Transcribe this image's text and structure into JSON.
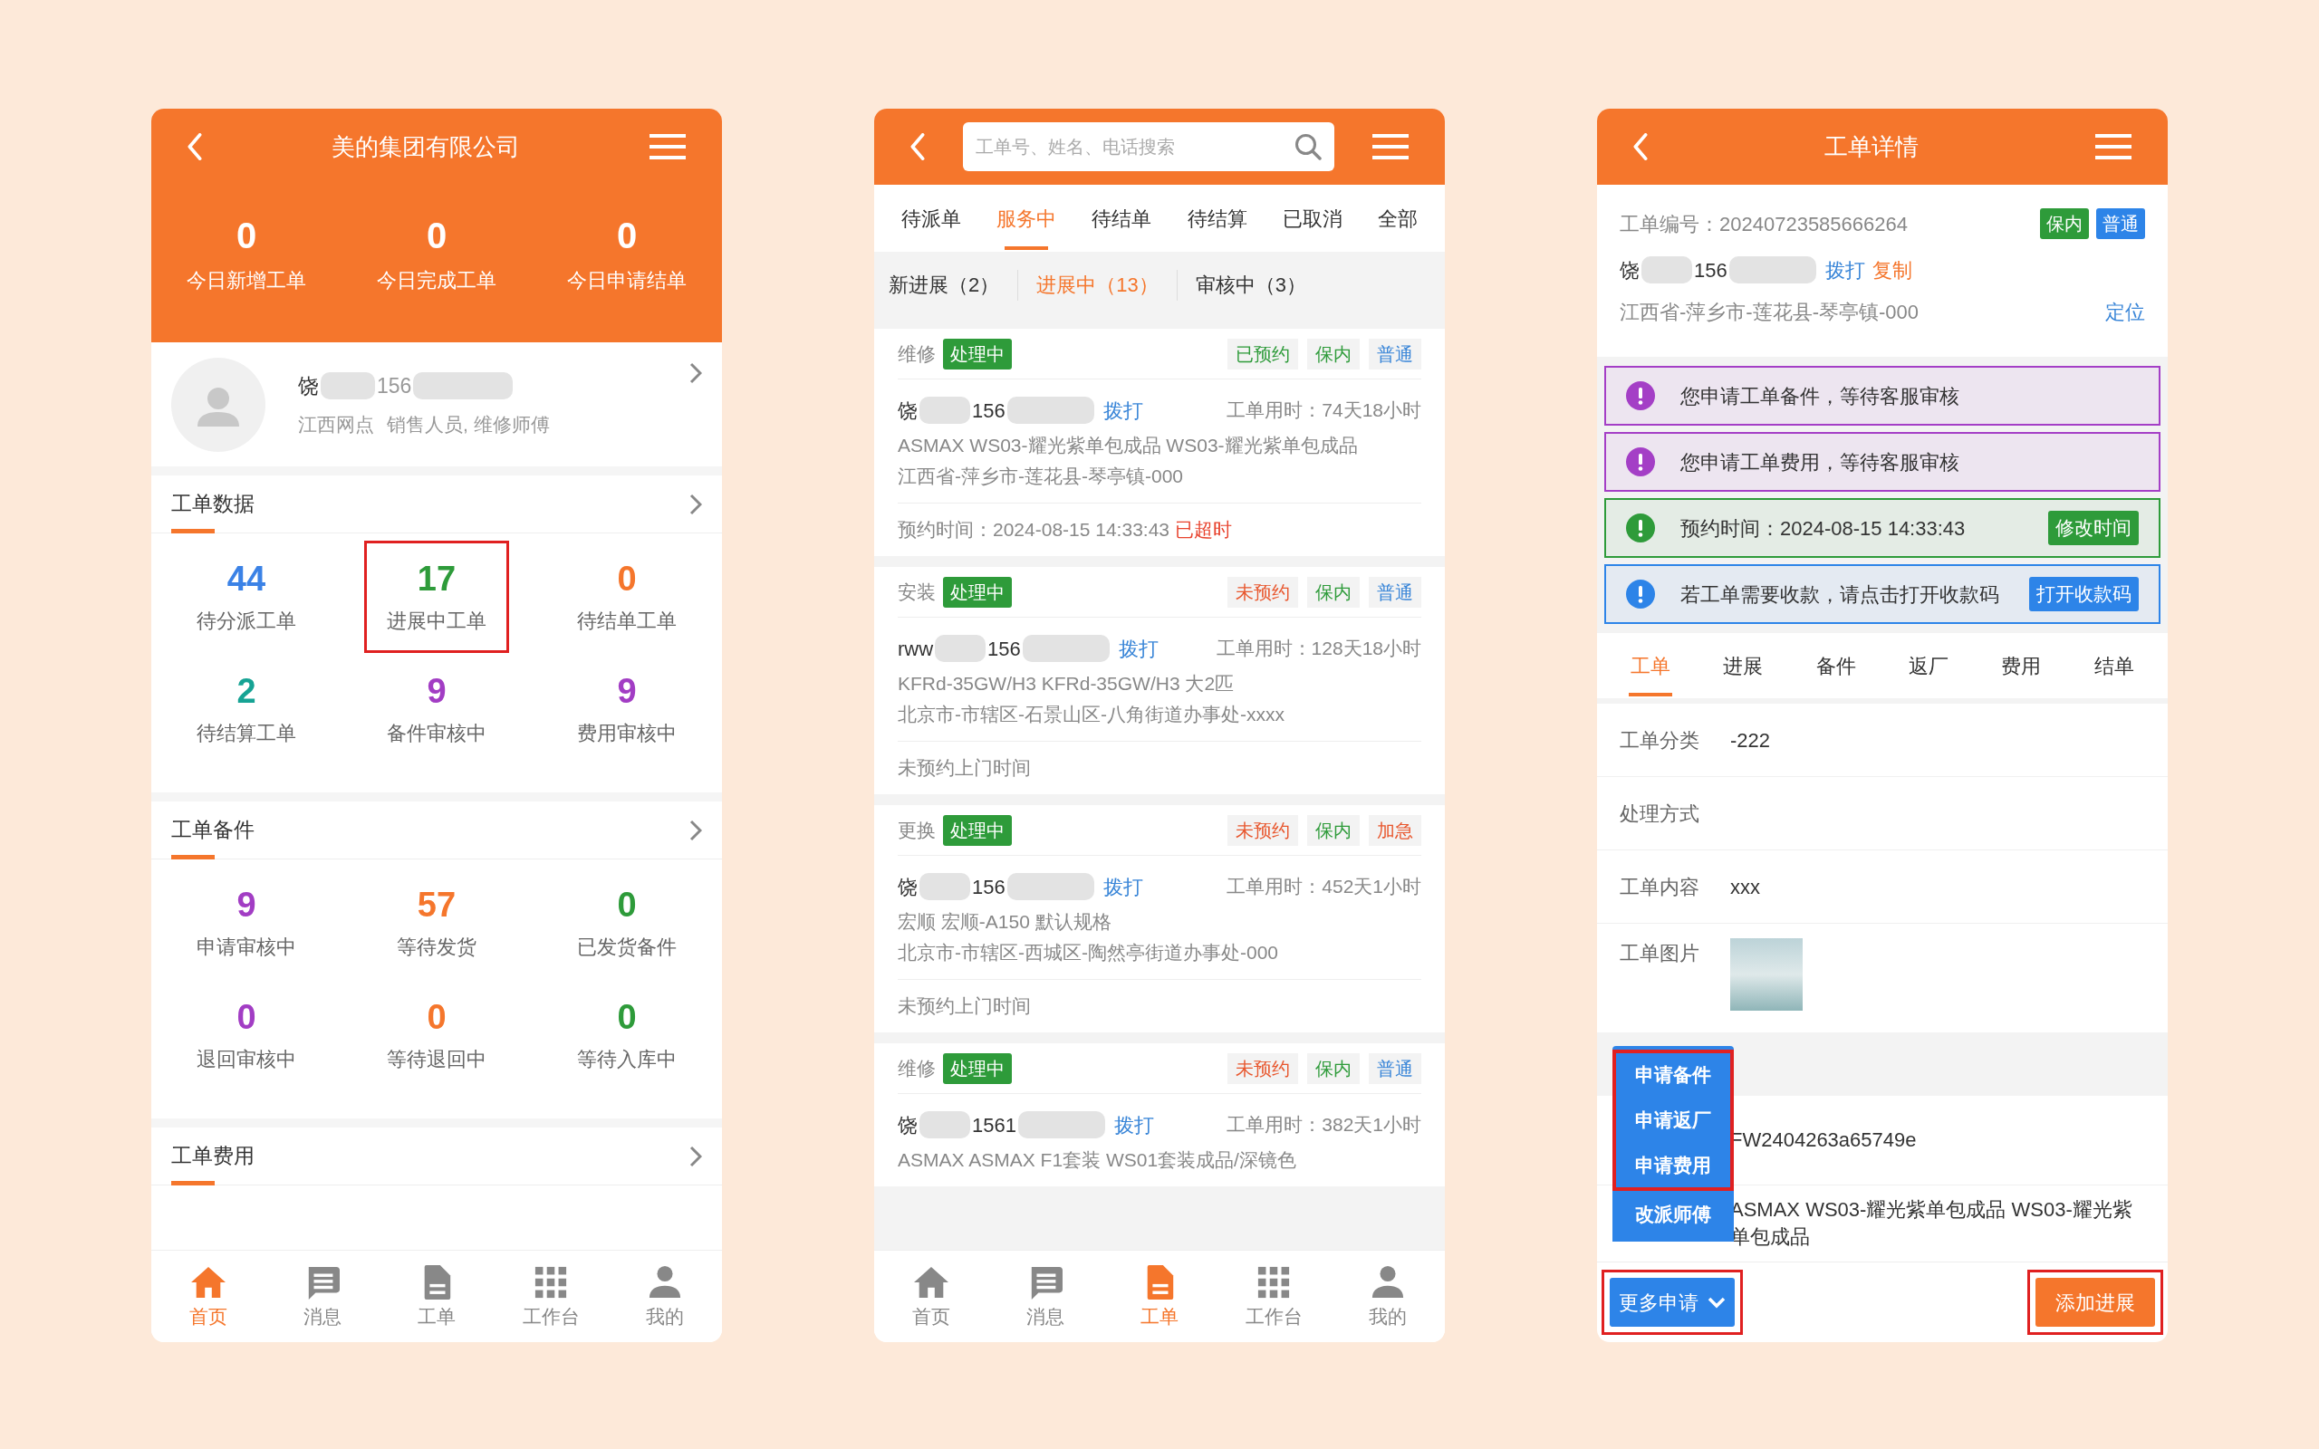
{
  "home_screen": {
    "title": "美的集团有限公司",
    "today_stats": [
      {
        "value": "0",
        "label": "今日新增工单"
      },
      {
        "value": "0",
        "label": "今日完成工单"
      },
      {
        "value": "0",
        "label": "今日申请结单"
      }
    ],
    "profile": {
      "name": "饶",
      "phone": "156",
      "org": "江西网点",
      "roles": "销售人员, 维修师傅"
    },
    "sections": [
      {
        "title": "工单数据",
        "stats": [
          {
            "value": "44",
            "label": "待分派工单",
            "color": "#3b82e6",
            "highlighted": false
          },
          {
            "value": "17",
            "label": "进展中工单",
            "color": "#2e9b3a",
            "highlighted": true
          },
          {
            "value": "0",
            "label": "待结单工单",
            "color": "#f5762c",
            "highlighted": false
          },
          {
            "value": "2",
            "label": "待结算工单",
            "color": "#16a394",
            "highlighted": false
          },
          {
            "value": "9",
            "label": "备件审核中",
            "color": "#a23dc4",
            "highlighted": false
          },
          {
            "value": "9",
            "label": "费用审核中",
            "color": "#a23dc4",
            "highlighted": false
          }
        ]
      },
      {
        "title": "工单备件",
        "stats": [
          {
            "value": "9",
            "label": "申请审核中",
            "color": "#a23dc4",
            "highlighted": false
          },
          {
            "value": "57",
            "label": "等待发货",
            "color": "#f5762c",
            "highlighted": false
          },
          {
            "value": "0",
            "label": "已发货备件",
            "color": "#2e9b3a",
            "highlighted": false
          },
          {
            "value": "0",
            "label": "退回审核中",
            "color": "#a23dc4",
            "highlighted": false
          },
          {
            "value": "0",
            "label": "等待退回中",
            "color": "#f5762c",
            "highlighted": false
          },
          {
            "value": "0",
            "label": "等待入库中",
            "color": "#2e9b3a",
            "highlighted": false
          }
        ]
      },
      {
        "title": "工单费用"
      }
    ],
    "nav": [
      {
        "label": "首页",
        "selected": true
      },
      {
        "label": "消息",
        "selected": false
      },
      {
        "label": "工单",
        "selected": false
      },
      {
        "label": "工作台",
        "selected": false
      },
      {
        "label": "我的",
        "selected": false
      }
    ]
  },
  "order_list_screen": {
    "search": {
      "placeholder": "工单号、姓名、电话搜索"
    },
    "tabs": [
      {
        "label": "待派单",
        "selected": false
      },
      {
        "label": "服务中",
        "selected": true
      },
      {
        "label": "待结单",
        "selected": false
      },
      {
        "label": "待结算",
        "selected": false
      },
      {
        "label": "已取消",
        "selected": false
      },
      {
        "label": "全部",
        "selected": false
      }
    ],
    "sub_tabs": [
      {
        "label": "新进展（2）",
        "selected": false
      },
      {
        "label": "进展中（13）",
        "selected": true
      },
      {
        "label": "审核中（3）",
        "selected": false
      }
    ],
    "orders": [
      {
        "type": "维修",
        "status": "处理中",
        "tags": [
          {
            "text": "已预约",
            "color": "#2e9b3a"
          },
          {
            "text": "保内",
            "color": "#2e9b3a"
          },
          {
            "text": "普通",
            "color": "#3a86d8"
          }
        ],
        "name": "饶",
        "phone": "156",
        "call": "拨打",
        "duration": "工单用时：74天18小时",
        "product": "ASMAX WS03-耀光紫单包成品 WS03-耀光紫单包成品",
        "address": "江西省-萍乡市-莲花县-琴亭镇-000",
        "appointment": "预约时间：2024-08-15 14:33:43",
        "overdue": "已超时"
      },
      {
        "type": "安装",
        "status": "处理中",
        "tags": [
          {
            "text": "未预约",
            "color": "#e8572e"
          },
          {
            "text": "保内",
            "color": "#2e9b3a"
          },
          {
            "text": "普通",
            "color": "#3a86d8"
          }
        ],
        "name": "rww",
        "phone": "156",
        "call": "拨打",
        "duration": "工单用时：128天18小时",
        "product": "KFRd-35GW/H3 KFRd-35GW/H3 大2匹",
        "address": "北京市-市辖区-石景山区-八角街道办事处-xxxx",
        "appointment": "未预约上门时间"
      },
      {
        "type": "更换",
        "status": "处理中",
        "tags": [
          {
            "text": "未预约",
            "color": "#e8572e"
          },
          {
            "text": "保内",
            "color": "#2e9b3a"
          },
          {
            "text": "加急",
            "color": "#e8572e"
          }
        ],
        "name": "饶",
        "phone": "156",
        "call": "拨打",
        "duration": "工单用时：452天1小时",
        "product": "宏顺 宏顺-A150 默认规格",
        "address": "北京市-市辖区-西城区-陶然亭街道办事处-000",
        "appointment": "未预约上门时间"
      },
      {
        "type": "维修",
        "status": "处理中",
        "tags": [
          {
            "text": "未预约",
            "color": "#e8572e"
          },
          {
            "text": "保内",
            "color": "#2e9b3a"
          },
          {
            "text": "普通",
            "color": "#3a86d8"
          }
        ],
        "name": "饶",
        "phone": "1561",
        "call": "拨打",
        "duration": "工单用时：382天1小时",
        "product": "ASMAX ASMAX F1套装 WS01套装成品/深镜色"
      }
    ],
    "nav": [
      {
        "label": "首页",
        "selected": false
      },
      {
        "label": "消息",
        "selected": false
      },
      {
        "label": "工单",
        "selected": true
      },
      {
        "label": "工作台",
        "selected": false
      },
      {
        "label": "我的",
        "selected": false
      }
    ]
  },
  "order_detail_screen": {
    "title": "工单详情",
    "order_no": "工单编号：20240723585666264",
    "tags": [
      {
        "text": "保内",
        "color": "#2e9b3a"
      },
      {
        "text": "普通",
        "color": "#2d84e8"
      }
    ],
    "name": "饶",
    "phone": "156",
    "call": "拨打",
    "copy": "复制",
    "address": "江西省-萍乡市-莲花县-琴亭镇-000",
    "locate": "定位",
    "notices": [
      {
        "text": "您申请工单备件，等待客服审核",
        "color": "#a43fc6"
      },
      {
        "text": "您申请工单费用，等待客服审核",
        "color": "#a43fc6"
      },
      {
        "text": "预约时间：2024-08-15 14:33:43",
        "color": "#2e9b3a",
        "action": "修改时间"
      },
      {
        "text": "若工单需要收款，请点击打开收款码",
        "color": "#2d84e8",
        "action": "打开收款码"
      }
    ],
    "tabs": [
      {
        "label": "工单",
        "selected": true
      },
      {
        "label": "进展",
        "selected": false
      },
      {
        "label": "备件",
        "selected": false
      },
      {
        "label": "返厂",
        "selected": false
      },
      {
        "label": "费用",
        "selected": false
      },
      {
        "label": "结单",
        "selected": false
      }
    ],
    "fields": [
      {
        "kind": "text",
        "label": "工单分类",
        "value": "-222"
      },
      {
        "kind": "text",
        "label": "处理方式"
      },
      {
        "kind": "text",
        "label": "工单内容",
        "value": "xxx"
      },
      {
        "kind": "image",
        "label": "工单图片"
      }
    ],
    "lower_values": [
      "FW2404263a65749e",
      "ASMAX WS03-耀光紫单包成品 WS03-耀光紫单包成品"
    ],
    "menu": [
      {
        "text": "申请备件",
        "highlighted": true
      },
      {
        "text": "申请返厂",
        "highlighted": true
      },
      {
        "text": "申请费用",
        "highlighted": true
      },
      {
        "text": "改派师傅",
        "highlighted": false
      }
    ],
    "more_button": {
      "text": "更多申请",
      "highlighted": true
    },
    "add_button": {
      "text": "添加进展",
      "highlighted": true
    }
  }
}
